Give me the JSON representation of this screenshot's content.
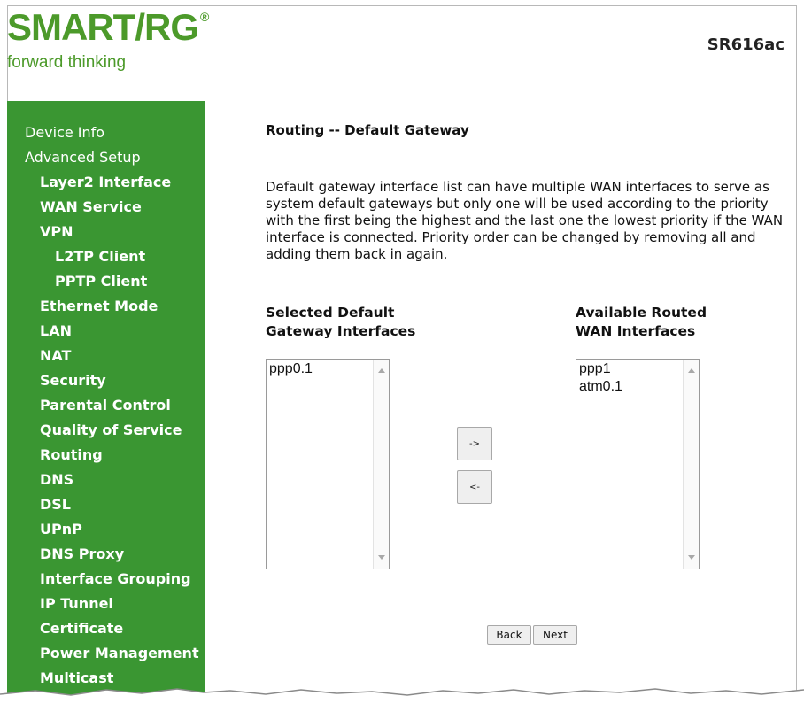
{
  "header": {
    "logo_text": "SMART/RG",
    "logo_reg": "®",
    "tagline": "forward thinking",
    "model": "SR616ac"
  },
  "sidebar": {
    "items": [
      {
        "label": "Device Info",
        "level": 0
      },
      {
        "label": "Advanced Setup",
        "level": 0
      },
      {
        "label": "Layer2 Interface",
        "level": 1
      },
      {
        "label": "WAN Service",
        "level": 1
      },
      {
        "label": "VPN",
        "level": 1
      },
      {
        "label": "L2TP Client",
        "level": 2
      },
      {
        "label": "PPTP Client",
        "level": 2
      },
      {
        "label": "Ethernet Mode",
        "level": 1
      },
      {
        "label": "LAN",
        "level": 1
      },
      {
        "label": "NAT",
        "level": 1
      },
      {
        "label": "Security",
        "level": 1
      },
      {
        "label": "Parental Control",
        "level": 1
      },
      {
        "label": "Quality of Service",
        "level": 1
      },
      {
        "label": "Routing",
        "level": 1
      },
      {
        "label": "DNS",
        "level": 1
      },
      {
        "label": "DSL",
        "level": 1
      },
      {
        "label": "UPnP",
        "level": 1
      },
      {
        "label": "DNS Proxy",
        "level": 1
      },
      {
        "label": "Interface Grouping",
        "level": 1
      },
      {
        "label": "IP Tunnel",
        "level": 1
      },
      {
        "label": "Certificate",
        "level": 1
      },
      {
        "label": "Power Management",
        "level": 1
      },
      {
        "label": "Multicast",
        "level": 1
      }
    ]
  },
  "main": {
    "title": "Routing -- Default Gateway",
    "description": "Default gateway interface list can have multiple WAN interfaces to serve as system default gateways but only one will be used according to the priority with the first being the highest and the last one the lowest priority if the WAN interface is connected. Priority order can be changed by removing all and adding them back in again.",
    "selected": {
      "heading_line1": "Selected Default",
      "heading_line2": "Gateway Interfaces",
      "options": [
        "ppp0.1"
      ]
    },
    "available": {
      "heading_line1": "Available Routed",
      "heading_line2": "WAN Interfaces",
      "options": [
        "ppp1",
        "atm0.1"
      ]
    },
    "add_button": "->",
    "remove_button": "<-",
    "back_button": "Back",
    "next_button": "Next"
  },
  "colors": {
    "brand_green": "#4c9a2a",
    "sidebar_bg": "#3a9632"
  },
  "icons": {
    "scroll_up": "scroll-up-arrow-icon",
    "scroll_down": "scroll-down-arrow-icon"
  }
}
